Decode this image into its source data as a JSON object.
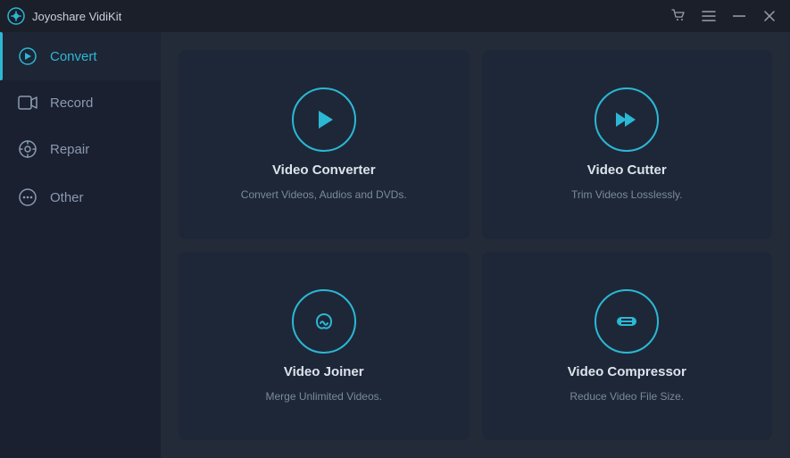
{
  "titleBar": {
    "appName": "Joyoshare VidiKit",
    "buttons": {
      "cart": "🛒",
      "menu": "☰",
      "minimize": "—",
      "close": "✕"
    }
  },
  "sidebar": {
    "items": [
      {
        "id": "convert",
        "label": "Convert",
        "active": true
      },
      {
        "id": "record",
        "label": "Record",
        "active": false
      },
      {
        "id": "repair",
        "label": "Repair",
        "active": false
      },
      {
        "id": "other",
        "label": "Other",
        "active": false
      }
    ]
  },
  "cards": [
    {
      "id": "video-converter",
      "title": "Video Converter",
      "desc": "Convert Videos, Audios and DVDs."
    },
    {
      "id": "video-cutter",
      "title": "Video Cutter",
      "desc": "Trim Videos Losslessly."
    },
    {
      "id": "video-joiner",
      "title": "Video Joiner",
      "desc": "Merge Unlimited Videos."
    },
    {
      "id": "video-compressor",
      "title": "Video Compressor",
      "desc": "Reduce Video File Size."
    }
  ]
}
